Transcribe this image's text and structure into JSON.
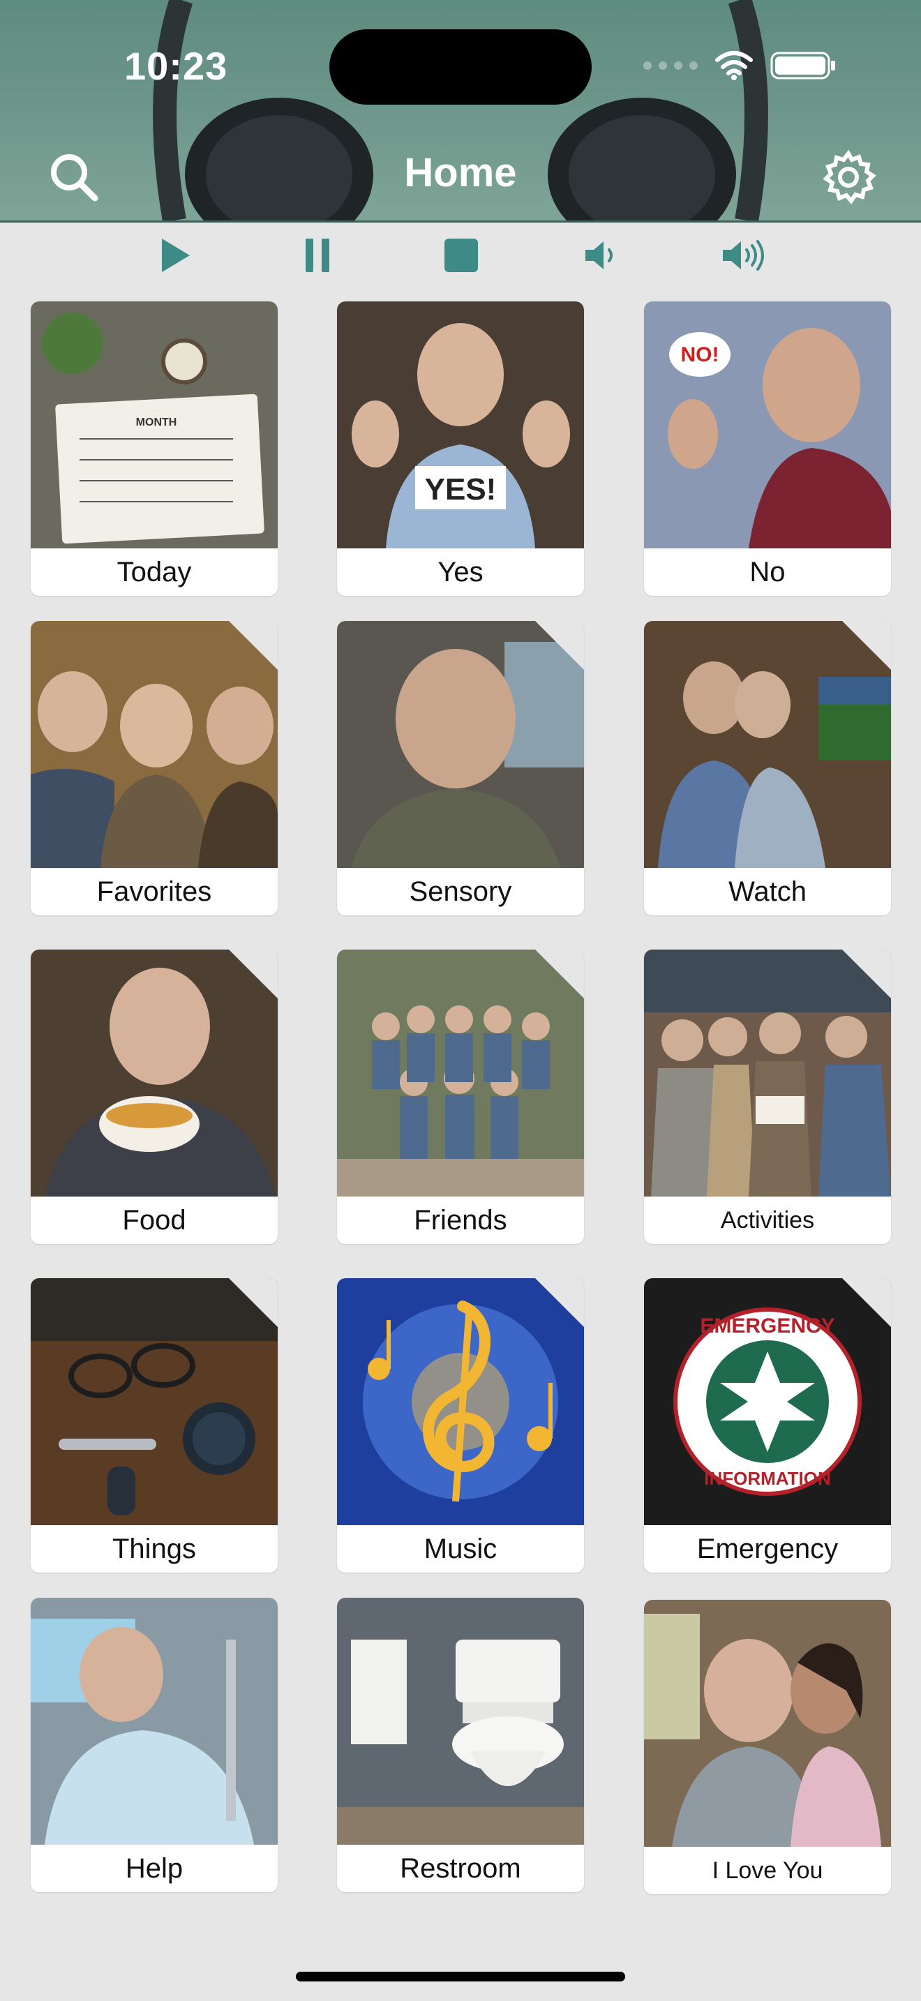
{
  "status_bar": {
    "time": "10:23"
  },
  "nav": {
    "title": "Home",
    "search_icon": "search-icon",
    "settings_icon": "gear-icon"
  },
  "controls": [
    {
      "name": "play-button",
      "icon": "play-icon"
    },
    {
      "name": "pause-button",
      "icon": "pause-icon"
    },
    {
      "name": "stop-button",
      "icon": "stop-icon"
    },
    {
      "name": "volume-down-button",
      "icon": "volume-low-icon"
    },
    {
      "name": "volume-up-button",
      "icon": "volume-high-icon"
    }
  ],
  "tiles": [
    {
      "label": "Today",
      "folder": false
    },
    {
      "label": "Yes",
      "folder": false
    },
    {
      "label": "No",
      "folder": false
    },
    {
      "label": "Favorites",
      "folder": true
    },
    {
      "label": "Sensory",
      "folder": true
    },
    {
      "label": "Watch",
      "folder": true
    },
    {
      "label": "Food",
      "folder": true
    },
    {
      "label": "Friends",
      "folder": true
    },
    {
      "label": "Activities",
      "folder": true
    },
    {
      "label": "Things",
      "folder": true
    },
    {
      "label": "Music",
      "folder": true
    },
    {
      "label": "Emergency",
      "folder": true
    },
    {
      "label": "Help",
      "folder": false
    },
    {
      "label": "Restroom",
      "folder": false
    },
    {
      "label": "I Love You",
      "folder": false
    }
  ],
  "image_text": {
    "calendar_month": "MONTH",
    "yes_sign": "YES!",
    "no_bubble": "NO!",
    "emergency_top": "EMERGENCY",
    "emergency_bottom": "INFORMATION"
  },
  "colors": {
    "header": "#6a9488",
    "accent": "#3d8a87",
    "background": "#e6e6e6"
  }
}
